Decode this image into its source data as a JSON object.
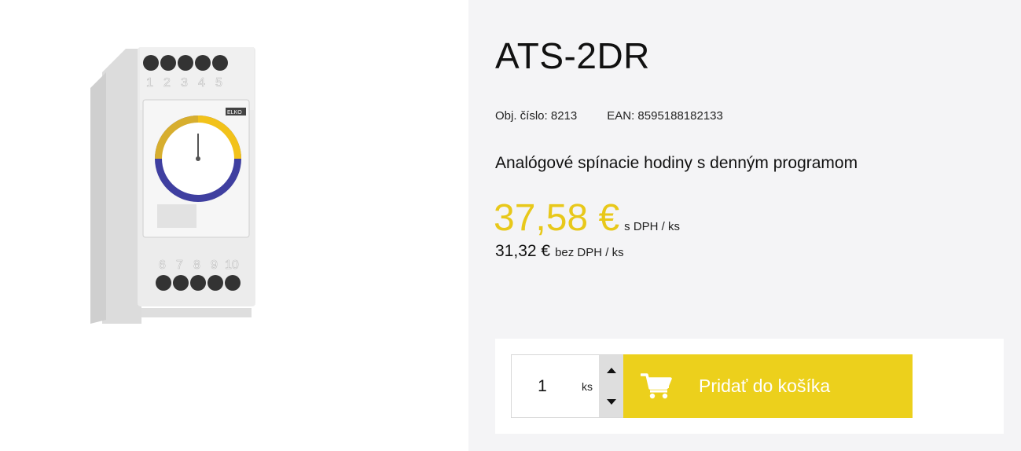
{
  "product": {
    "title": "ATS-2DR",
    "order_number_label": "Obj. číslo: 8213",
    "ean_label": "EAN: 8595188182133",
    "description": "Analógové spínacie hodiny s denným programom",
    "image_icon": "timer-switch-product-image",
    "image_texts": {
      "top_terminals": [
        "1",
        "2",
        "3",
        "4",
        "5"
      ],
      "bottom_terminals": [
        "6",
        "7",
        "8",
        "9",
        "10"
      ],
      "brand": "ELKO"
    }
  },
  "price": {
    "with_vat_value": "37,58 €",
    "with_vat_unit": "s DPH / ks",
    "without_vat_value": "31,32 €",
    "without_vat_unit": "bez DPH / ks"
  },
  "cart": {
    "quantity": "1",
    "quantity_unit": "ks",
    "add_label": "Pridať do košíka",
    "cart_icon": "shopping-cart-icon",
    "step_up_icon": "caret-up-icon",
    "step_down_icon": "caret-down-icon"
  },
  "colors": {
    "accent_yellow": "#ecd01c",
    "price_yellow": "#e8c81a",
    "panel_background": "#f4f4f6",
    "dial_blue": "#3f3fa0",
    "dial_yellow": "#f2c21a"
  }
}
